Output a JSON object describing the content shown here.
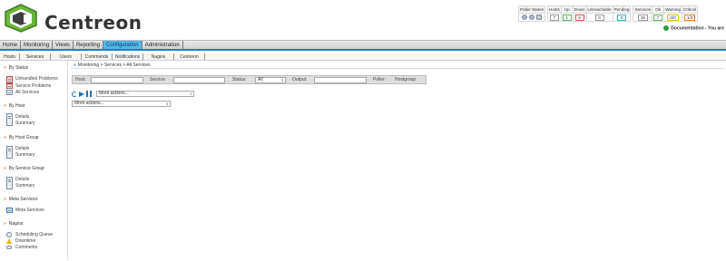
{
  "app": {
    "brand": "Centreon",
    "documentation_text": "Documentation - You are"
  },
  "status_table": {
    "headers": [
      "Poller States",
      "Hosts",
      "Up",
      "Down",
      "Unreachable",
      "Pending",
      "Services",
      "Ok",
      "Warning",
      "Critical"
    ],
    "values": {
      "hosts": "7",
      "up": "1",
      "down": "6",
      "unreachable": "0",
      "pending": "0",
      "services": "18",
      "ok": "7",
      "warning": "0/0",
      "critical": "1/3"
    }
  },
  "top_menu": {
    "items": [
      "Home",
      "Monitoring",
      "Views",
      "Reporting",
      "Configuration",
      "Administration"
    ],
    "active": "Configuration"
  },
  "sub_menu": {
    "items": [
      "Hosts",
      "Services",
      "Users",
      "Commands",
      "Notifications",
      "Nagios",
      "Centreon"
    ]
  },
  "sidebar": {
    "sections": [
      {
        "title": "By Status",
        "items": [
          "Unhandled Problems",
          "Service Problems",
          "All Services"
        ]
      },
      {
        "title": "By Host",
        "items": [
          "Details",
          "Summary"
        ]
      },
      {
        "title": "By Host Group",
        "items": [
          "Details",
          "Summary"
        ]
      },
      {
        "title": "By Service Group",
        "items": [
          "Details",
          "Summary"
        ]
      },
      {
        "title": "Meta Services",
        "items": [
          "Meta Services"
        ]
      },
      {
        "title": "Nagios",
        "items": [
          "Scheduling Queue",
          "Downtime",
          "Comments"
        ]
      }
    ]
  },
  "breadcrumb": {
    "text": "Monitoring > Services > All Services"
  },
  "filters": {
    "host_label": "Host:",
    "service_label": "Service:",
    "status_label": "Status:",
    "status_value": "All",
    "output_label": "Output:",
    "poller_label": "Poller:",
    "hostgroup_label": "Hostgroup:"
  },
  "toolbar": {
    "more_actions_top": "More actions...",
    "more_actions_bottom": "More actions..."
  },
  "colors": {
    "active_tab": "#56b6e6",
    "menu_underline": "#1d7fbf",
    "section_arrow": "#e8741c",
    "icon_blue": "#1f73b7"
  }
}
